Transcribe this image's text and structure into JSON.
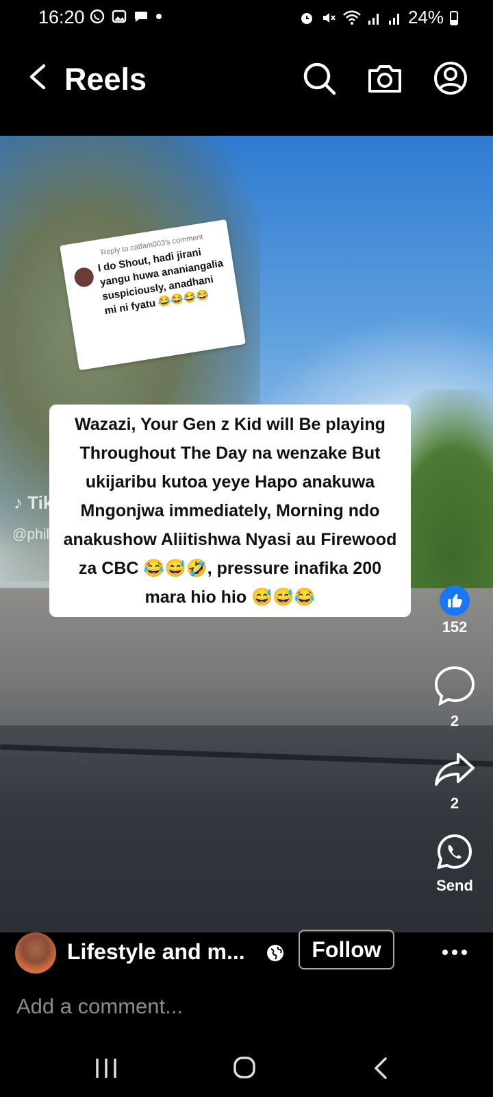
{
  "status_bar": {
    "time": "16:20",
    "battery": "24%"
  },
  "header": {
    "title": "Reels"
  },
  "reel": {
    "reply_card": {
      "header": "Reply to catfam003's comment",
      "text": "I do Shout, hadi jirani yangu huwa ananiangalia suspiciously, anadhani mi ni fyatu 😂😂😂😂"
    },
    "caption": "Wazazi, Your Gen z Kid will Be playing Throughout The Day na wenzake But ukijaribu kutoa yeye Hapo anakuwa Mngonjwa immediately, Morning ndo anakushow Aliitishwa Nyasi au Firewood za CBC 😂😅🤣, pressure inafika 200 mara hio hio 😅😅😂",
    "watermark": "TikTok",
    "watermark_handle": "@phillip"
  },
  "actions": {
    "likes": "152",
    "comments": "2",
    "shares": "2",
    "send_label": "Send"
  },
  "author": {
    "name": "Lifestyle and m...",
    "follow_label": "Follow"
  },
  "comment_input": {
    "placeholder": "Add a comment..."
  },
  "colors": {
    "like_blue": "#1877f2",
    "background": "#000000"
  }
}
